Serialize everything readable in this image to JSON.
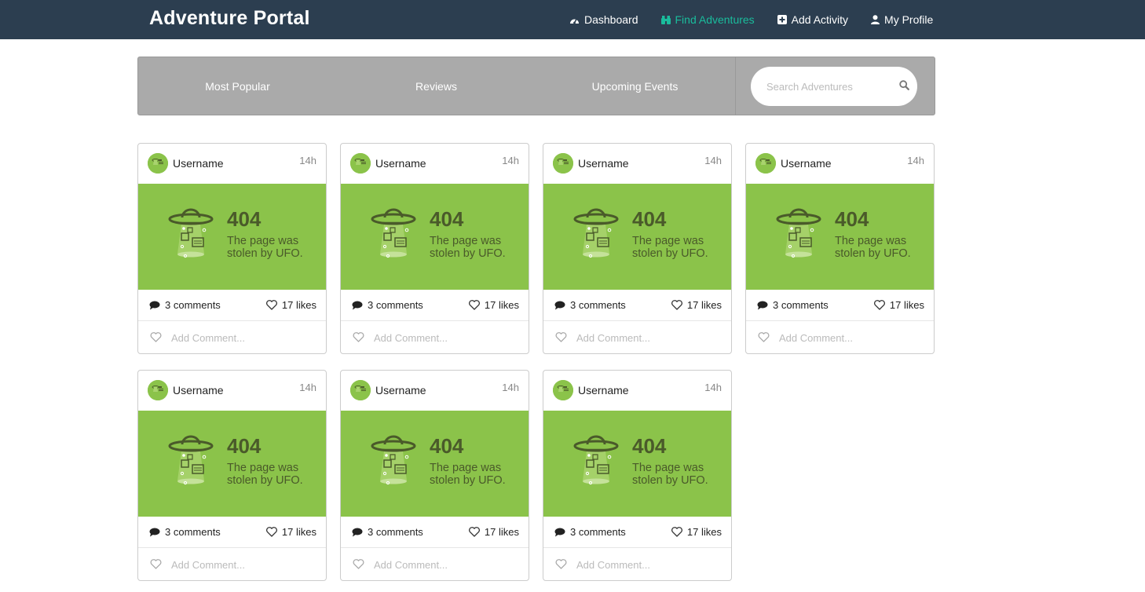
{
  "app": {
    "title": "Adventure Portal"
  },
  "nav": [
    {
      "label": "Dashboard",
      "icon": "dashboard-icon",
      "active": false
    },
    {
      "label": "Find Adventures",
      "icon": "binoculars-icon",
      "active": true
    },
    {
      "label": "Add Activity",
      "icon": "plus-square-icon",
      "active": false
    },
    {
      "label": "My Profile",
      "icon": "user-icon",
      "active": false
    }
  ],
  "tabs": [
    {
      "label": "Most Popular"
    },
    {
      "label": "Reviews"
    },
    {
      "label": "Upcoming Events"
    }
  ],
  "search": {
    "placeholder": "Search Adventures",
    "value": ""
  },
  "posts": [
    {
      "username": "Username",
      "time": "14h",
      "image_code": "404",
      "image_line1": "The page was",
      "image_line2": "stolen by UFO.",
      "comments": "3 comments",
      "likes": "17 likes",
      "comment_placeholder": "Add Comment..."
    },
    {
      "username": "Username",
      "time": "14h",
      "image_code": "404",
      "image_line1": "The page was",
      "image_line2": "stolen by UFO.",
      "comments": "3 comments",
      "likes": "17 likes",
      "comment_placeholder": "Add Comment..."
    },
    {
      "username": "Username",
      "time": "14h",
      "image_code": "404",
      "image_line1": "The page was",
      "image_line2": "stolen by UFO.",
      "comments": "3 comments",
      "likes": "17 likes",
      "comment_placeholder": "Add Comment..."
    },
    {
      "username": "Username",
      "time": "14h",
      "image_code": "404",
      "image_line1": "The page was",
      "image_line2": "stolen by UFO.",
      "comments": "3 comments",
      "likes": "17 likes",
      "comment_placeholder": "Add Comment..."
    },
    {
      "username": "Username",
      "time": "14h",
      "image_code": "404",
      "image_line1": "The page was",
      "image_line2": "stolen by UFO.",
      "comments": "3 comments",
      "likes": "17 likes",
      "comment_placeholder": "Add Comment..."
    },
    {
      "username": "Username",
      "time": "14h",
      "image_code": "404",
      "image_line1": "The page was",
      "image_line2": "stolen by UFO.",
      "comments": "3 comments",
      "likes": "17 likes",
      "comment_placeholder": "Add Comment..."
    },
    {
      "username": "Username",
      "time": "14h",
      "image_code": "404",
      "image_line1": "The page was",
      "image_line2": "stolen by UFO.",
      "comments": "3 comments",
      "likes": "17 likes",
      "comment_placeholder": "Add Comment..."
    }
  ],
  "colors": {
    "navbar": "#2c3e50",
    "accent": "#1abc9c",
    "tabbar": "#aaaaaa",
    "image_bg": "#8bc34a"
  }
}
